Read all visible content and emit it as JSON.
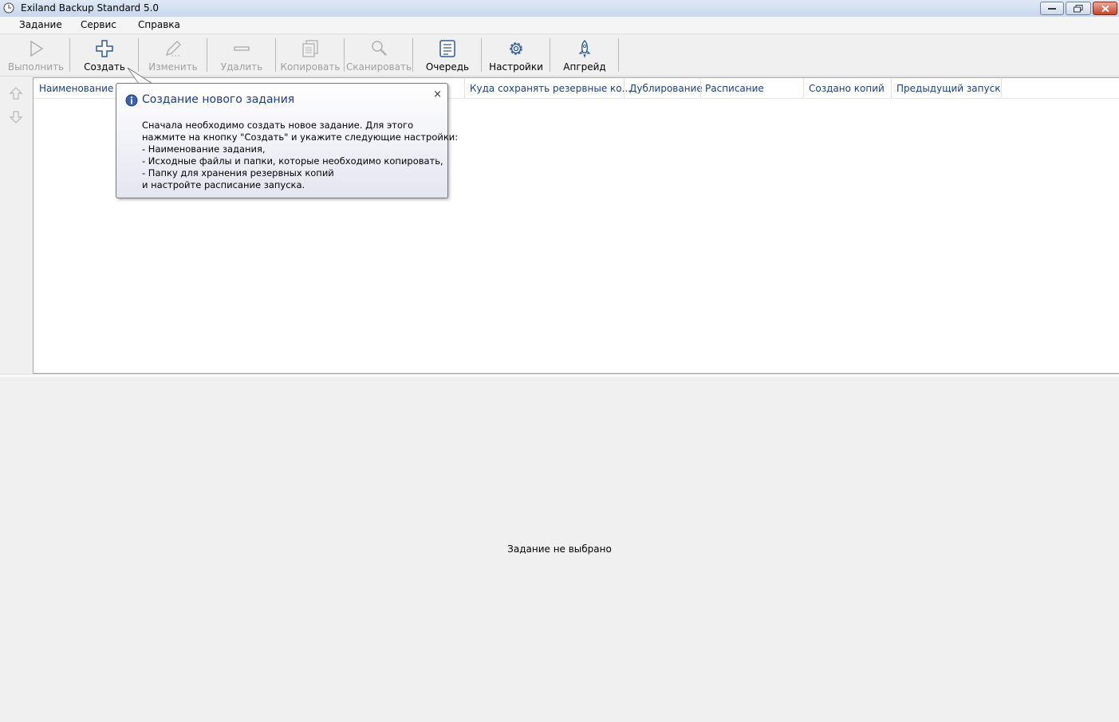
{
  "window": {
    "title": "Exiland Backup Standard 5.0"
  },
  "menu": [
    "Задание",
    "Сервис",
    "Справка"
  ],
  "toolbar": {
    "run": "Выполнить",
    "create": "Создать",
    "edit": "Изменить",
    "delete": "Удалить",
    "copy": "Копировать",
    "scan": "Сканировать",
    "queue": "Очередь",
    "settings": "Настройки",
    "upgrade": "Апгрейд"
  },
  "table": {
    "columns": [
      "Наименование",
      "Куда сохранять резервные ко...",
      "Дублирование",
      "Расписание",
      "Создано копий",
      "Предыдущий запуск"
    ]
  },
  "tooltip": {
    "title": "Создание нового задания",
    "close": "×",
    "lines": [
      "Сначала необходимо создать новое задание. Для этого",
      "нажмите на кнопку \"Создать\" и укажите следующие настройки:",
      "- Наименование задания,",
      "- Исходные файлы и папки, которые необходимо копировать,",
      "- Папку для хранения резервных копий",
      "и настройте расписание запуска."
    ]
  },
  "details": {
    "status": "Задание не выбрано"
  },
  "colors": {
    "header_text": "#1a3f80",
    "icon_blue": "#2d5a9a",
    "disabled_text": "#a0a0a0"
  }
}
